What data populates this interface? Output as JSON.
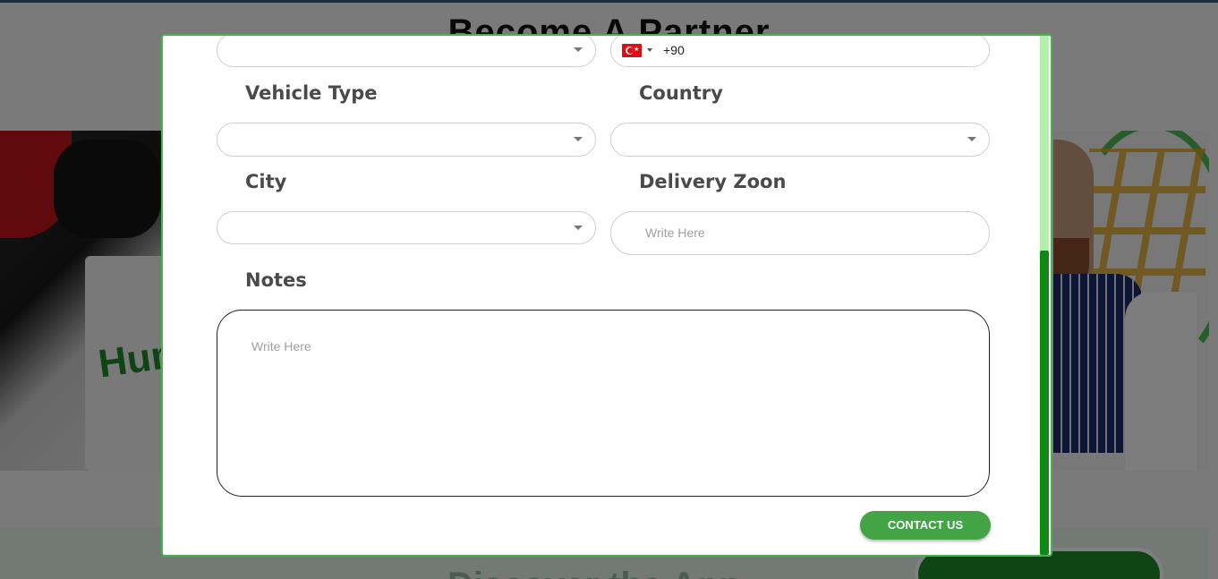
{
  "background": {
    "title": "Become A Partner",
    "bag_logo": "Hum",
    "bottom_heading": "Discover the App"
  },
  "modal": {
    "phone": {
      "country_flag": "turkey-flag-icon",
      "dial_code": "+90"
    },
    "vehicle_type": {
      "label": "Vehicle Type",
      "value": ""
    },
    "country": {
      "label": "Country",
      "value": ""
    },
    "city": {
      "label": "City",
      "value": ""
    },
    "delivery_zone": {
      "label": "Delivery Zoon",
      "placeholder": "Write Here"
    },
    "notes": {
      "label": "Notes",
      "placeholder": "Write Here"
    },
    "submit_label": "CONTACT US"
  },
  "colors": {
    "accent_green": "#43a446",
    "modal_border": "#47b34d",
    "scroll_thumb": "#0e8a12",
    "label_gray": "#4a4a4a"
  }
}
